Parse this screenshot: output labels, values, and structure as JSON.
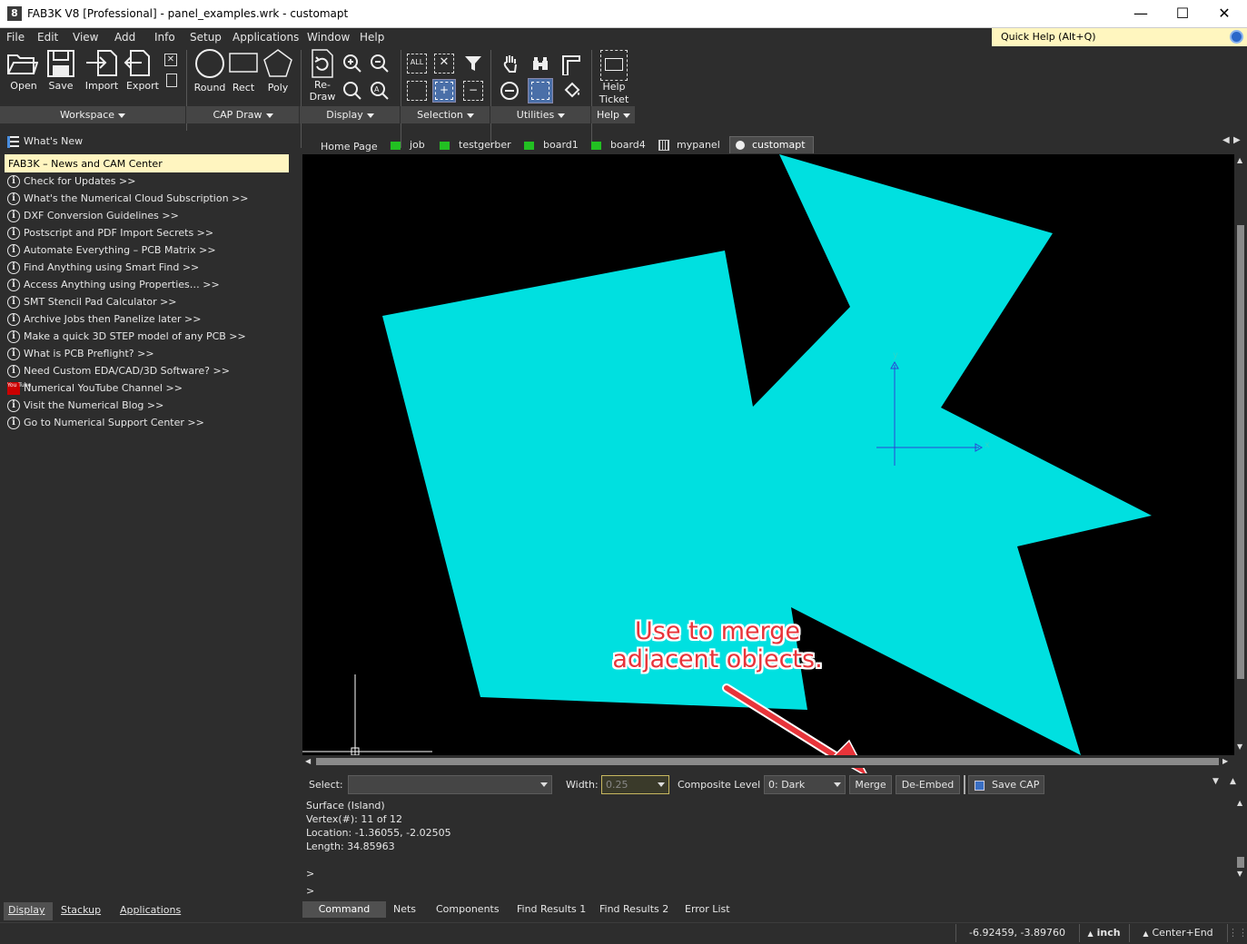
{
  "window": {
    "title": "FAB3K V8 [Professional] - panel_examples.wrk - customapt",
    "icon_glyph": "8",
    "controls": [
      "—",
      "☐",
      "✕"
    ]
  },
  "menu": [
    "File",
    "Edit",
    "View",
    "Add",
    "Info",
    "Setup",
    "Applications",
    "Window",
    "Help"
  ],
  "quick_help": "Quick Help (Alt+Q)",
  "toolbar": {
    "open": "Open",
    "save": "Save",
    "import": "Import",
    "export": "Export",
    "round": "Round",
    "rect": "Rect",
    "poly": "Poly",
    "redraw_1": "Re-",
    "redraw_2": "Draw",
    "all_label": "ALL",
    "help_ticket_1": "Help",
    "help_ticket_2": "Ticket",
    "groups": [
      "Workspace",
      "CAP Draw",
      "Display",
      "Selection",
      "Utilities",
      "Help"
    ]
  },
  "left_panel": {
    "whats_new": "What's New",
    "news_header": "FAB3K – News and CAM Center",
    "links": [
      "Check for Updates >>",
      "What's the Numerical Cloud Subscription >>",
      "DXF Conversion Guidelines >>",
      "Postscript and PDF Import Secrets >>",
      "Automate Everything – PCB Matrix >>",
      "Find Anything using Smart Find >>",
      "Access Anything using Properties… >>",
      "SMT Stencil Pad Calculator >>",
      "Archive Jobs then Panelize later >>",
      "Make a quick 3D STEP model of any PCB >>",
      "What is PCB Preflight? >>",
      "Need Custom EDA/CAD/3D Software? >>",
      "Numerical YouTube Channel >>",
      "Visit the Numerical Blog >>",
      "Go to Numerical Support Center >>"
    ],
    "youtube_glyph": "You Tube",
    "tabs": [
      "Display",
      "Stackup",
      "Applications"
    ]
  },
  "doc_tabs": [
    "Home Page",
    "job",
    "testgerber",
    "board1",
    "board4",
    "mypanel",
    "customapt"
  ],
  "canvas": {
    "axis_x_label": "x",
    "axis_y_label": "y"
  },
  "selbar": {
    "select_label": "Select:",
    "select_value": "",
    "width_label": "Width:",
    "width_value": "0.25",
    "composite_label": "Composite Level",
    "composite_value": "0: Dark",
    "merge": "Merge",
    "de_embed": "De-Embed",
    "save_cap": "Save CAP"
  },
  "cmd_output": [
    "Surface (Island)",
    "Vertex(#): 11 of 12",
    "Location: -1.36055, -2.02505",
    "Length: 34.85963",
    "",
    ">",
    ">"
  ],
  "cmd_tabs": [
    "Command",
    "Nets",
    "Components",
    "Find Results 1",
    "Find Results 2",
    "Error List"
  ],
  "status": {
    "coords": "-6.92459, -3.89760",
    "units": "inch",
    "center": "Center+End"
  },
  "annotation": {
    "line1": "Use to merge",
    "line2": "adjacent objects."
  },
  "colors": {
    "shape_fill": "#00e0e0",
    "axis": "#2b46d6",
    "annotation": "#e8343a",
    "quick_help_bg": "#fff6bf"
  }
}
